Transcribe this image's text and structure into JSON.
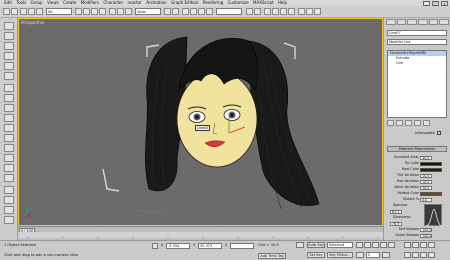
{
  "menu": [
    "Edit",
    "Tools",
    "Group",
    "Views",
    "Create",
    "Modifiers",
    "Character",
    "reactor",
    "Animation",
    "Graph Editors",
    "Rendering",
    "Customize",
    "MAXScript",
    "Help"
  ],
  "window_controls": [
    "_",
    "□",
    "x"
  ],
  "toolbar": {
    "selection_filter": "All",
    "ref_coord": "View"
  },
  "viewport": {
    "label": "Perspective",
    "object_tag": "Line04",
    "frame_color": "#f1c232",
    "background": "#6b6b6b"
  },
  "command_panel": {
    "object_name": "Line07",
    "modifier_list": "Modifier List",
    "stack": [
      "HairAndFurStyleWSM",
      "Extrude",
      "Line"
    ],
    "selected_stack_index": 0,
    "interpolate_label": "Interpolate",
    "interpolate_checked": "✓",
    "rollout_title": "Material Parameters",
    "params": [
      {
        "label": "Occluded Amb.",
        "value": "40.0"
      },
      {
        "label": "Tip Color",
        "swatch": "#1a1208"
      },
      {
        "label": "Root Color",
        "swatch": "#2a1a0a"
      },
      {
        "label": "Tint Variation",
        "value": "10.0"
      },
      {
        "label": "Hue Variation",
        "value": "10.0"
      },
      {
        "label": "Value Variation",
        "value": "50.0"
      },
      {
        "label": "Mutant Color",
        "swatch": "#6a4a1a"
      },
      {
        "label": "Mutant %",
        "value": "0.0"
      },
      {
        "label": "Specular",
        "value": ""
      },
      {
        "label": "",
        "value": "61.3"
      },
      {
        "label": "Glossiness",
        "value": ""
      },
      {
        "label": "",
        "value": "76.9"
      },
      {
        "label": "Self Shadow",
        "value": "100.0"
      },
      {
        "label": "Geom Shadow",
        "value": "100.0"
      },
      {
        "label": "Geom Mat ID",
        "value": "1"
      }
    ]
  },
  "time_slider": {
    "label": "0 / 100"
  },
  "status": {
    "selection_count": "1 Object Selected",
    "prompt": "Click and drag to pan a non-camera view",
    "x_label": "X",
    "x_value": "-3.354",
    "y_label": "Y",
    "y_value": "35.373",
    "z_label": "Z",
    "z_value": "",
    "grid": "Grid = 10.0",
    "add_time_tag": "Add Time Tag",
    "auto_key": "Auto Key",
    "selected": "Selected",
    "set_key": "Set Key",
    "key_filters": "Key Filters...",
    "frame": "0"
  }
}
